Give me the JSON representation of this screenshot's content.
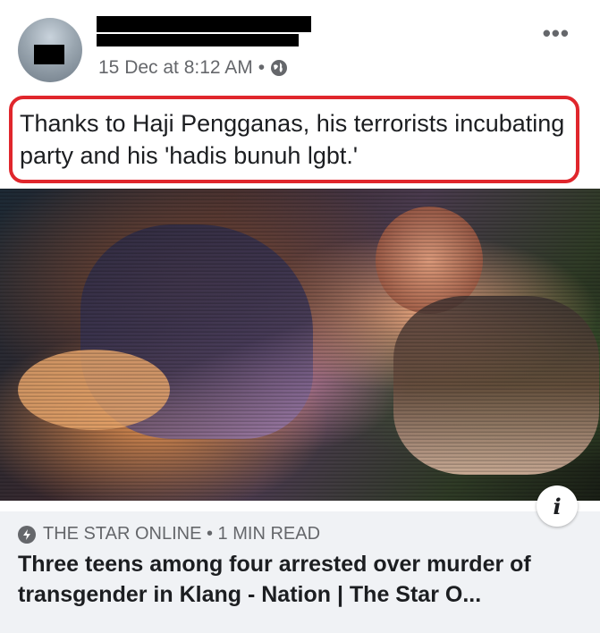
{
  "post": {
    "timestamp": "15 Dec at 8:12 AM",
    "separator": "•",
    "privacy_icon": "globe-icon",
    "more_icon": "ellipsis-icon",
    "more_label": "•••",
    "caption": "Thanks to Haji Pengganas, his terrorists incubating party and his 'hadis bunuh lgbt.'",
    "highlight_color": "#e0262c"
  },
  "link_preview": {
    "source": "THE STAR ONLINE • 1 MIN READ",
    "headline": "Three teens among four arrested over murder of transgender in Klang - Nation | The Star O...",
    "info_icon": "info-icon",
    "info_label": "i"
  }
}
